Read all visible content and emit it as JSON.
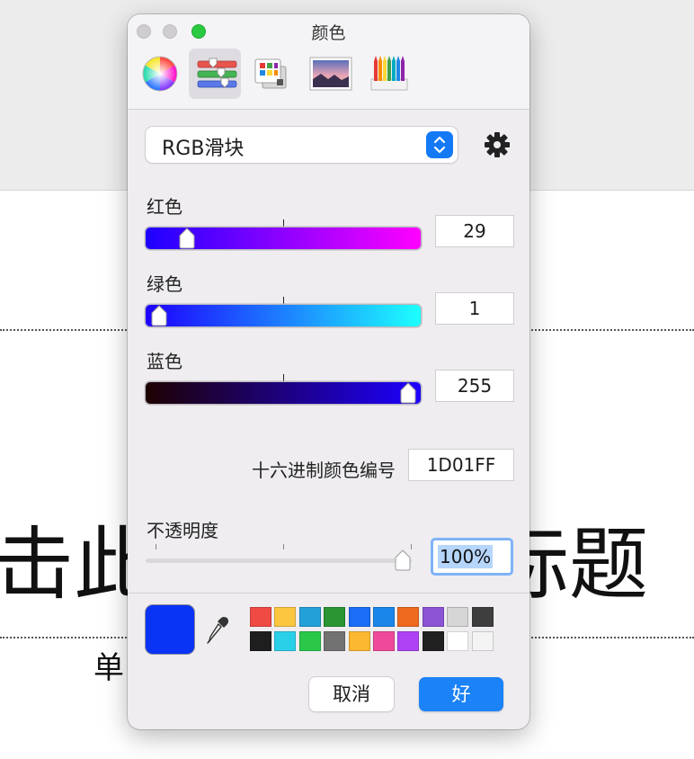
{
  "document": {
    "title_left": "击此",
    "title_right": "标题",
    "subtitle": "单"
  },
  "panel": {
    "title": "颜色",
    "tabs": [
      {
        "name": "color-wheel",
        "selected": false
      },
      {
        "name": "color-sliders",
        "selected": true
      },
      {
        "name": "color-palettes",
        "selected": false
      },
      {
        "name": "image-palettes",
        "selected": false
      },
      {
        "name": "pencils",
        "selected": false
      }
    ],
    "mode_select": {
      "value": "RGB滑块"
    },
    "sliders": [
      {
        "label": "红色",
        "value": "29",
        "fraction": 0.114,
        "gradient_start": "#1d01ff",
        "gradient_end": "#ff01ff"
      },
      {
        "label": "绿色",
        "value": "1",
        "fraction": 0.004,
        "gradient_start": "#1d00ff",
        "gradient_end": "#1dffff"
      },
      {
        "label": "蓝色",
        "value": "255",
        "fraction": 1.0,
        "gradient_start": "#1d0100",
        "gradient_end": "#1d01ff"
      }
    ],
    "hex": {
      "label": "十六进制颜色编号",
      "value": "1D01FF"
    },
    "opacity": {
      "label": "不透明度",
      "value": "100%",
      "fraction": 1.0
    },
    "current_color": "#0a34f5",
    "swatches": [
      "#f04a45",
      "#fbc640",
      "#22a0d8",
      "#2a9532",
      "#1a6ef5",
      "#1a86ea",
      "#ee6a1e",
      "#8a54d4",
      "#d6d6d6",
      "#3e3e3e",
      "#1e1e1e",
      "#2ad0e8",
      "#2ac748",
      "#727272",
      "#fbb830",
      "#ef4a9a",
      "#ae42f4",
      "#212121",
      "#ffffff",
      "#f4f4f4"
    ],
    "buttons": {
      "cancel": "取消",
      "ok": "好"
    }
  }
}
